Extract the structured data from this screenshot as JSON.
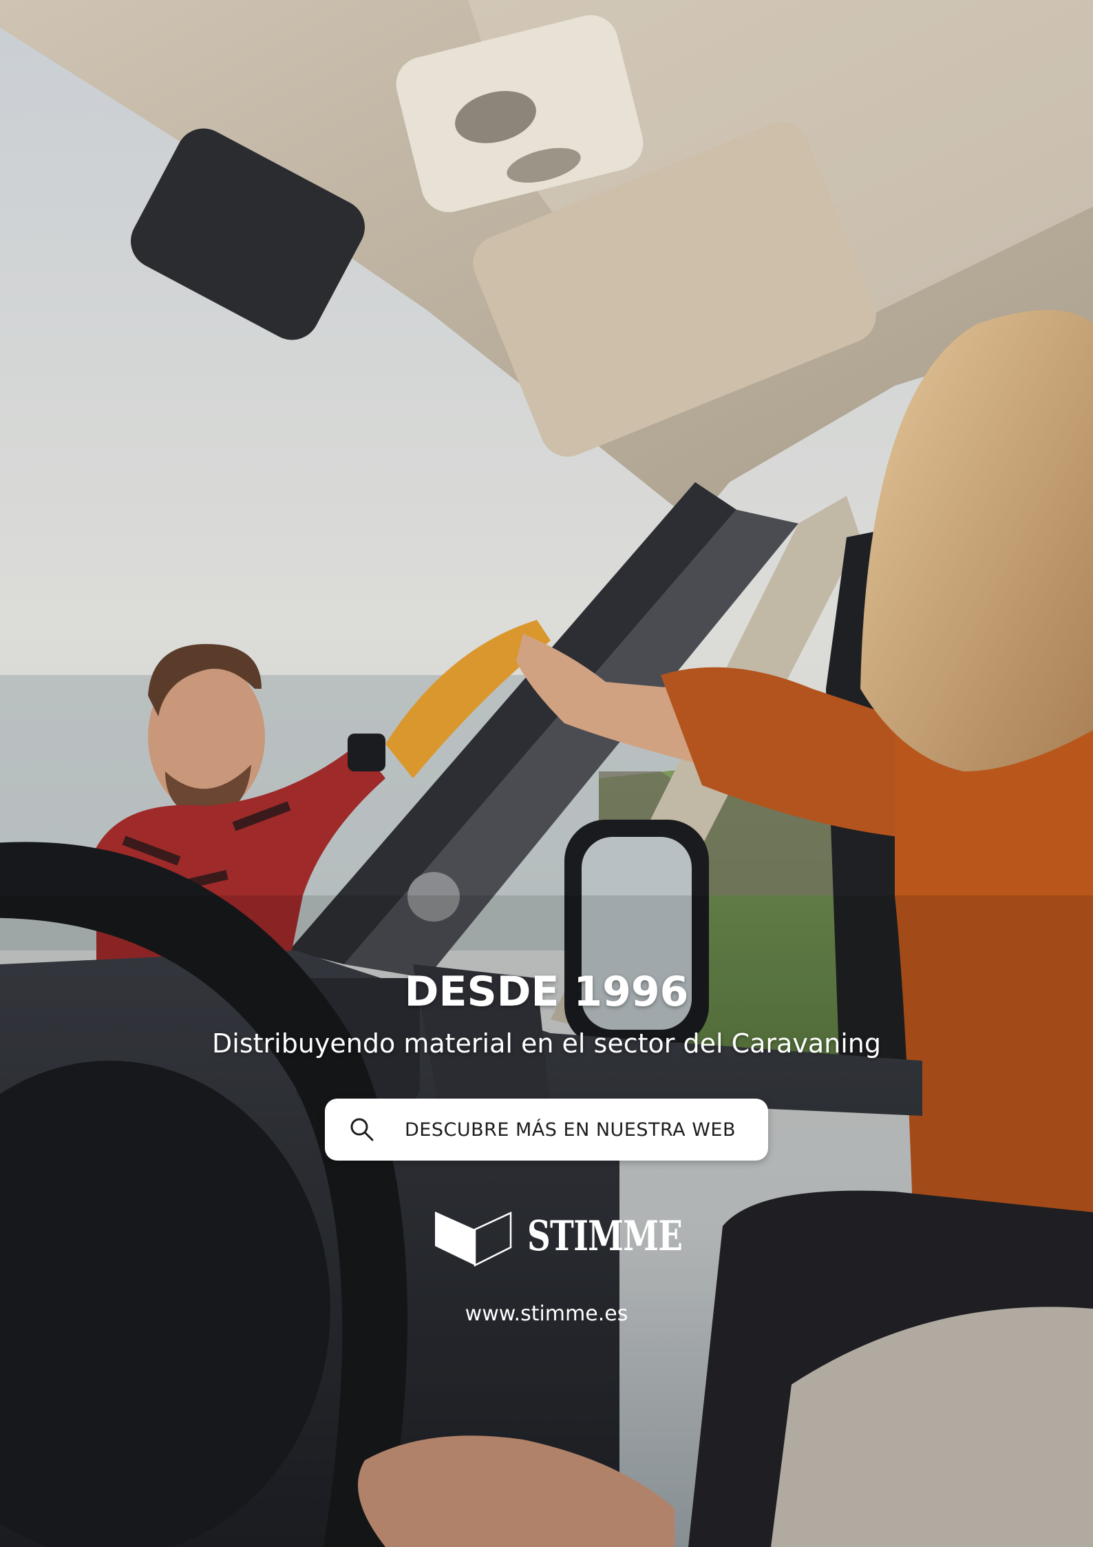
{
  "hero": {
    "title": "DESDE 1996",
    "subtitle": "Distribuyendo material en el sector del Caravaning"
  },
  "cta": {
    "label": "DESCUBRE MÁS EN NUESTRA WEB",
    "icon": "search-icon"
  },
  "brand": {
    "name": "STIMME",
    "icon": "stimme-logo-icon",
    "website": "www.stimme.es"
  },
  "colors": {
    "cta_background": "#ffffff",
    "text": "#ffffff",
    "cta_text": "#1d1d1d"
  }
}
